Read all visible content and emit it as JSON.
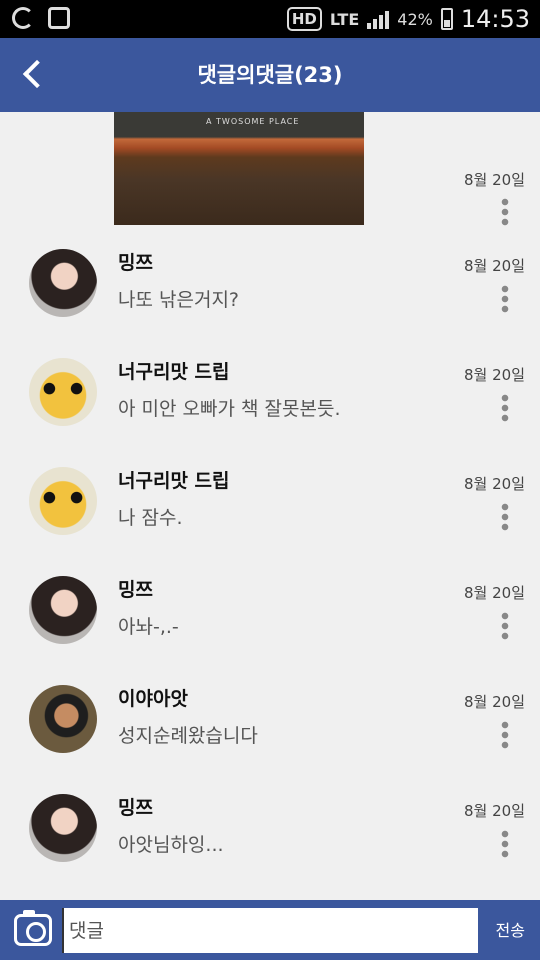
{
  "status_bar": {
    "hd": "HD",
    "network": "LTE",
    "battery": "42%",
    "time": "14:53",
    "icons": [
      "sync-icon",
      "image-icon",
      "signal-icon",
      "battery-icon"
    ]
  },
  "header": {
    "title": "댓글의댓글(23)",
    "back_icon": "chevron-left-icon",
    "color": "#3b579d"
  },
  "photo": {
    "caption": "A TWOSOME PLACE",
    "date": "8월 20일"
  },
  "comments": [
    {
      "author": "밍쯔",
      "text": "나또 낚은거지?",
      "date": "8월 20일",
      "avatar": "lady"
    },
    {
      "author": "너구리맛 드립",
      "text": "아 미안 오빠가 책 잘못본듯.",
      "date": "8월 20일",
      "avatar": "raccoon"
    },
    {
      "author": "너구리맛 드립",
      "text": "나 잠수.",
      "date": "8월 20일",
      "avatar": "raccoon"
    },
    {
      "author": "밍쯔",
      "text": "아놔-,.-",
      "date": "8월 20일",
      "avatar": "lady"
    },
    {
      "author": "이야아앗",
      "text": "성지순례왔습니다",
      "date": "8월 20일",
      "avatar": "man"
    },
    {
      "author": "밍쯔",
      "text": "아앗님하잉...",
      "date": "8월 20일",
      "avatar": "lady"
    }
  ],
  "composer": {
    "placeholder": "댓글",
    "send_label": "전송",
    "camera_icon": "camera-icon"
  }
}
